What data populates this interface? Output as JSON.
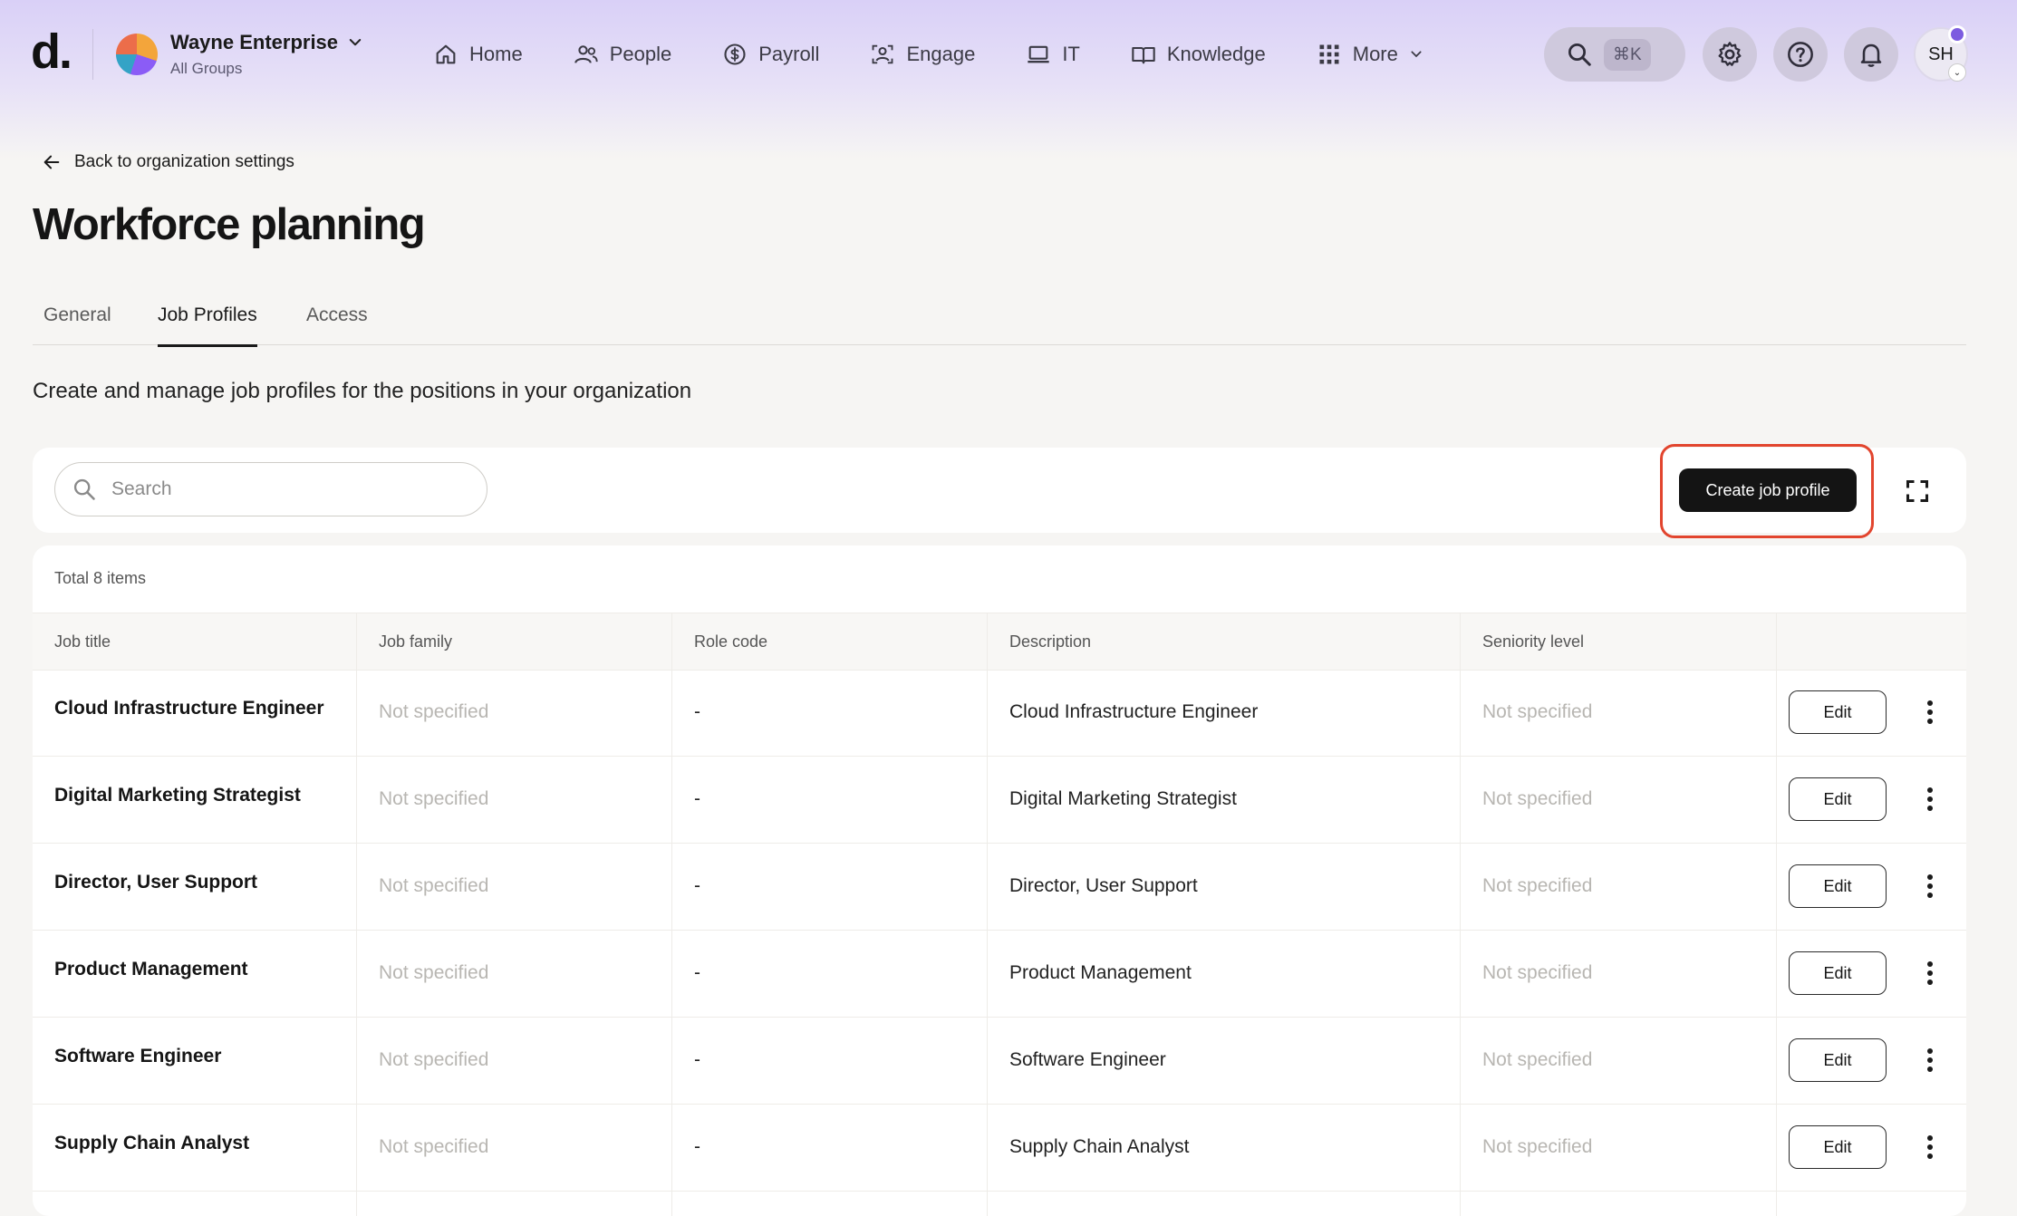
{
  "header": {
    "logo": "d.",
    "org_name": "Wayne Enterprise",
    "org_sub": "All Groups",
    "nav": [
      {
        "label": "Home",
        "icon": "home-icon"
      },
      {
        "label": "People",
        "icon": "people-icon"
      },
      {
        "label": "Payroll",
        "icon": "dollar-icon"
      },
      {
        "label": "Engage",
        "icon": "engage-icon"
      },
      {
        "label": "IT",
        "icon": "laptop-icon"
      },
      {
        "label": "Knowledge",
        "icon": "book-icon"
      },
      {
        "label": "More",
        "icon": "grid-icon"
      }
    ],
    "search_shortcut": "⌘K",
    "user_initials": "SH"
  },
  "page": {
    "back_label": "Back to organization settings",
    "title": "Workforce planning",
    "tabs": [
      "General",
      "Job Profiles",
      "Access"
    ],
    "active_tab": "Job Profiles",
    "subtitle": "Create and manage job profiles for the positions in your organization"
  },
  "toolbar": {
    "search_placeholder": "Search",
    "create_label": "Create job profile"
  },
  "table": {
    "total_label": "Total 8 items",
    "columns": [
      "Job title",
      "Job family",
      "Role code",
      "Description",
      "Seniority level"
    ],
    "edit_label": "Edit",
    "rows": [
      {
        "title": "Cloud Infrastructure Engineer",
        "family": "Not specified",
        "code": "-",
        "description": "Cloud Infrastructure Engineer",
        "seniority": "Not specified"
      },
      {
        "title": "Digital Marketing Strategist",
        "family": "Not specified",
        "code": "-",
        "description": "Digital Marketing Strategist",
        "seniority": "Not specified"
      },
      {
        "title": "Director, User Support",
        "family": "Not specified",
        "code": "-",
        "description": "Director, User Support",
        "seniority": "Not specified"
      },
      {
        "title": "Product Management",
        "family": "Not specified",
        "code": "-",
        "description": "Product Management",
        "seniority": "Not specified"
      },
      {
        "title": "Software Engineer",
        "family": "Not specified",
        "code": "-",
        "description": "Software Engineer",
        "seniority": "Not specified"
      },
      {
        "title": "Supply Chain Analyst",
        "family": "Not specified",
        "code": "-",
        "description": "Supply Chain Analyst",
        "seniority": "Not specified"
      }
    ]
  },
  "colors": {
    "accent_highlight": "#e2452e",
    "primary_button": "#141414",
    "header_tint": "#d9d0f7"
  }
}
